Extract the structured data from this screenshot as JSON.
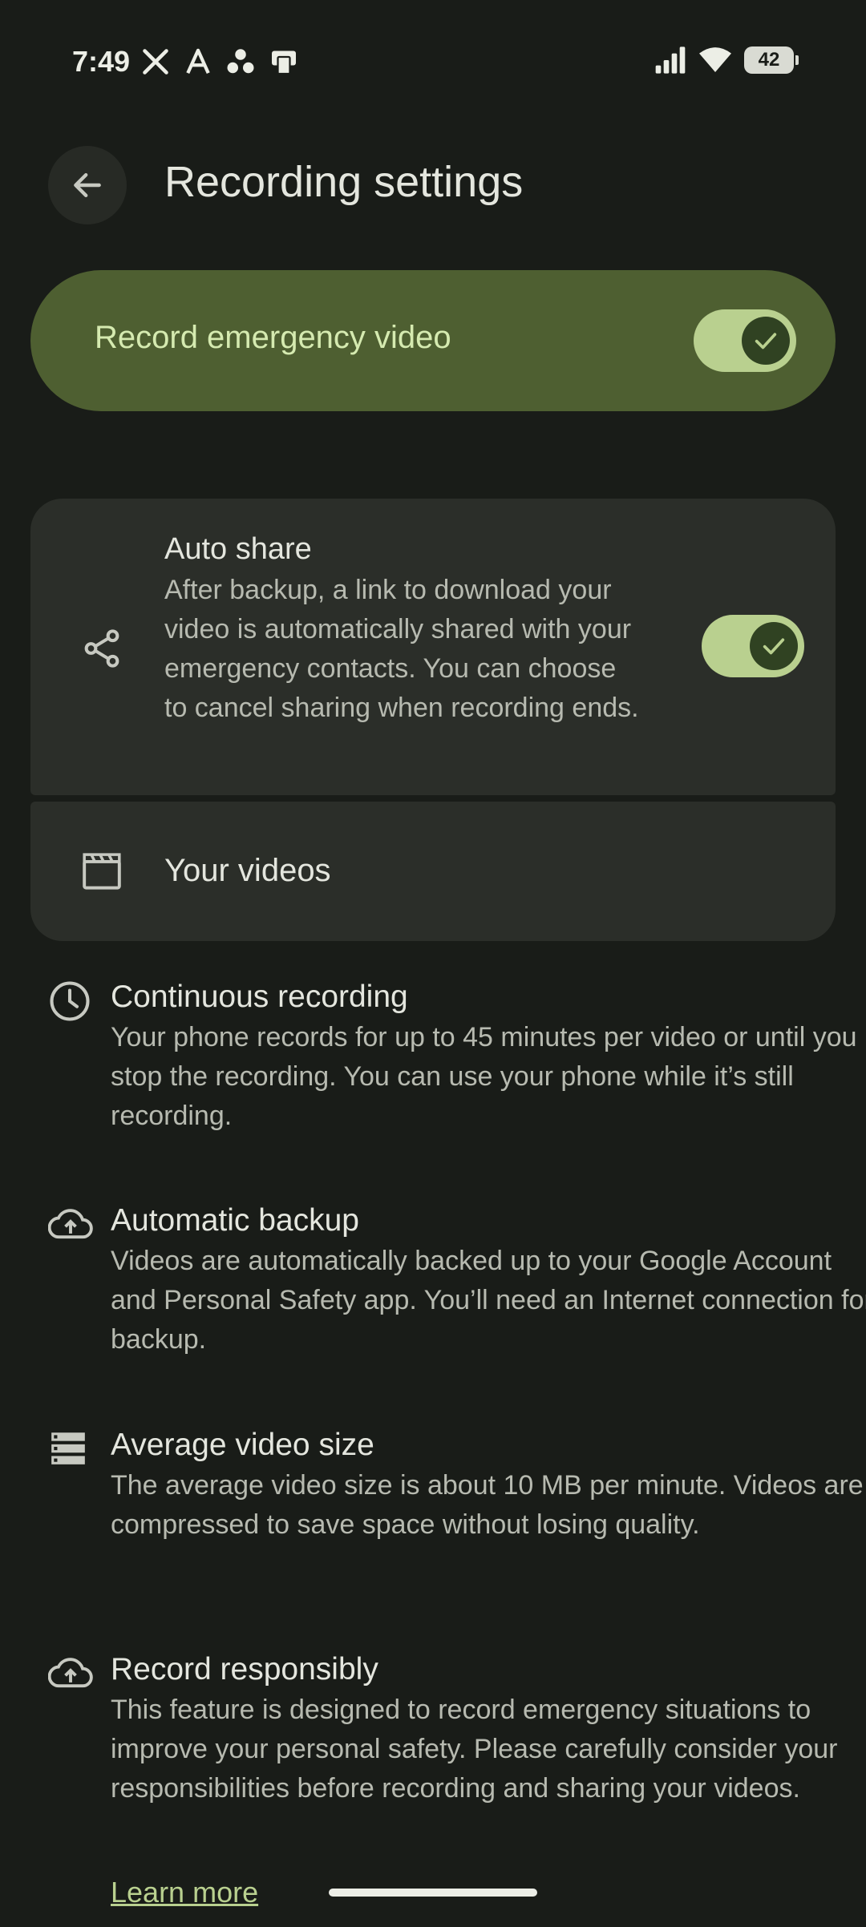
{
  "status_bar": {
    "time": "7:49",
    "battery": "42",
    "left_icons": [
      "x-logo-icon",
      "a-letter-icon",
      "dots-cluster-icon",
      "tablet-icon"
    ],
    "right_icons": [
      "cellular-signal-icon",
      "wifi-icon",
      "battery-icon"
    ]
  },
  "header": {
    "title": "Recording settings",
    "back_icon": "arrow-back-icon"
  },
  "master_toggle": {
    "label": "Record emergency video",
    "on": true
  },
  "settings": {
    "auto_share": {
      "title": "Auto share",
      "description": "After backup, a link to download your video is automatically shared with your emergency contacts. You can choose to cancel sharing when recording ends.",
      "icon": "share-icon",
      "on": true
    },
    "your_videos": {
      "label": "Your videos",
      "icon": "clapperboard-icon"
    }
  },
  "info_items": [
    {
      "title": "Continuous recording",
      "description": "Your phone records for up to 45 minutes per video or until you stop the recording. You can use your phone while it’s still recording.",
      "icon": "clock-icon"
    },
    {
      "title": "Automatic backup",
      "description": "Videos are automatically backed up to your Google Account and Personal Safety app. You’ll need an Internet connection for backup.",
      "icon": "cloud-upload-icon"
    },
    {
      "title": "Average video size",
      "description": "The average video size is about 10 MB per minute. Videos are compressed to save space without losing quality.",
      "icon": "storage-icon"
    },
    {
      "title": "Record responsibly",
      "description": "This feature is designed to record emergency situations to improve your personal safety. Please carefully consider your responsibilities before recording and sharing your videos.",
      "icon": "cloud-upload-icon"
    }
  ],
  "learn_more": "Learn more",
  "colors": {
    "background": "#191c18",
    "accent_container": "#4e5f31",
    "accent": "#b9d08f",
    "card": "#2b2e29"
  }
}
